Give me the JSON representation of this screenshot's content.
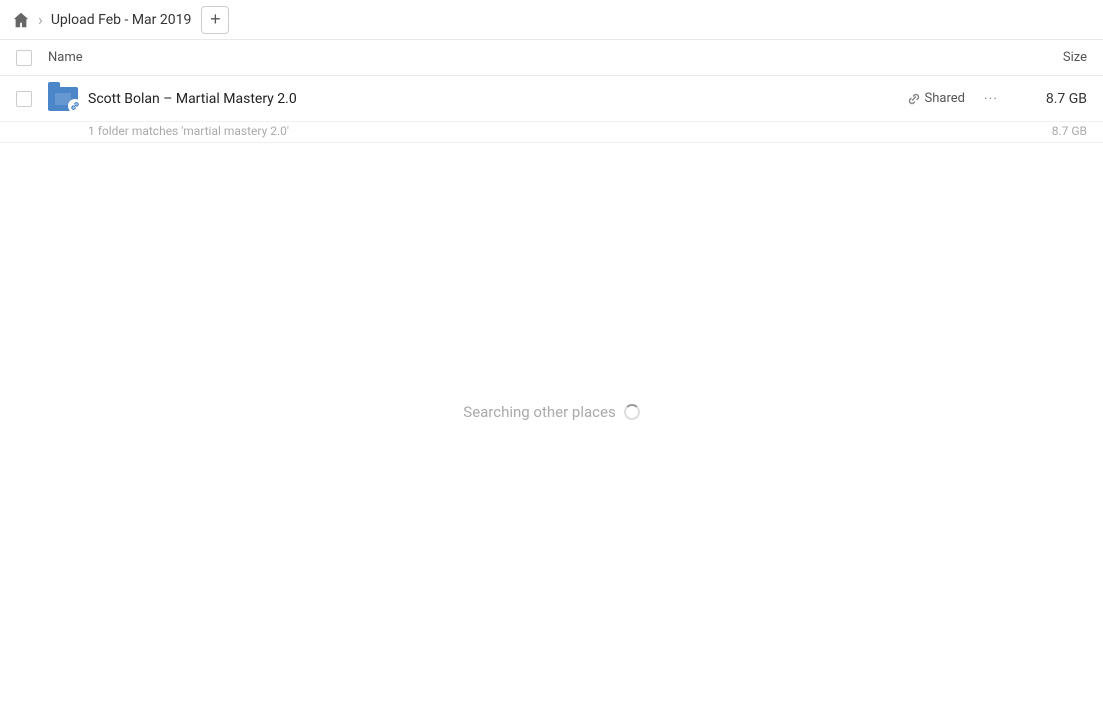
{
  "breadcrumb": {
    "home_label": "Home",
    "separator": "›",
    "title": "Upload Feb - Mar 2019",
    "add_button_label": "+"
  },
  "table": {
    "col_name": "Name",
    "col_size": "Size"
  },
  "files": [
    {
      "id": 1,
      "name": "Scott Bolan – Martial Mastery 2.0",
      "shared_label": "Shared",
      "size": "8.7 GB",
      "sub_info": "1 folder matches 'martial mastery 2.0'",
      "sub_size": "8.7 GB"
    }
  ],
  "searching": {
    "label": "Searching other places"
  }
}
